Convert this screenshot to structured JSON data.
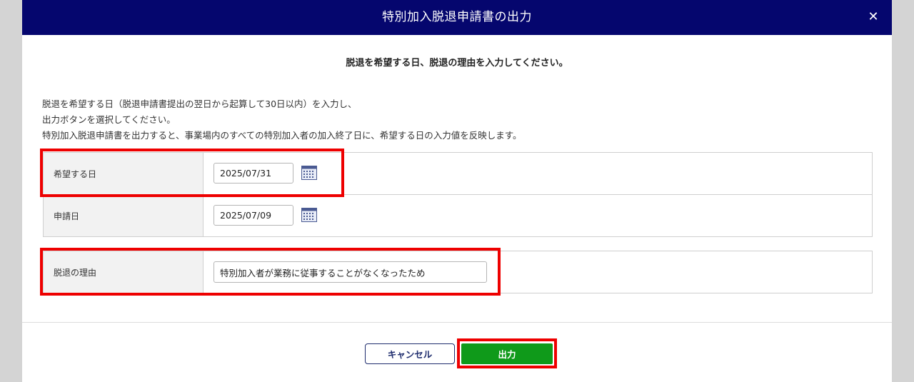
{
  "dialog": {
    "title": "特別加入脱退申請書の出力",
    "close_symbol": "✕",
    "heading": "脱退を希望する日、脱退の理由を入力してください。",
    "description": [
      "脱退を希望する日（脱退申請書提出の翌日から起算して30日以内）を入力し、",
      "出力ボタンを選択してください。",
      "特別加入脱退申請書を出力すると、事業場内のすべての特別加入者の加入終了日に、希望する日の入力値を反映します。"
    ]
  },
  "form": {
    "desired_date": {
      "label": "希望する日",
      "value": "2025/07/31",
      "icon": "calendar-icon"
    },
    "application_date": {
      "label": "申請日",
      "value": "2025/07/09",
      "icon": "calendar-icon"
    },
    "reason": {
      "label": "脱退の理由",
      "value": "特別加入者が業務に従事することがなくなったため"
    }
  },
  "buttons": {
    "cancel": "キャンセル",
    "output": "出力"
  },
  "colors": {
    "title_bar": "#05066e",
    "output_button": "#0f9a1a",
    "highlight": "#ee0000",
    "label_background": "#f2f2f2"
  }
}
